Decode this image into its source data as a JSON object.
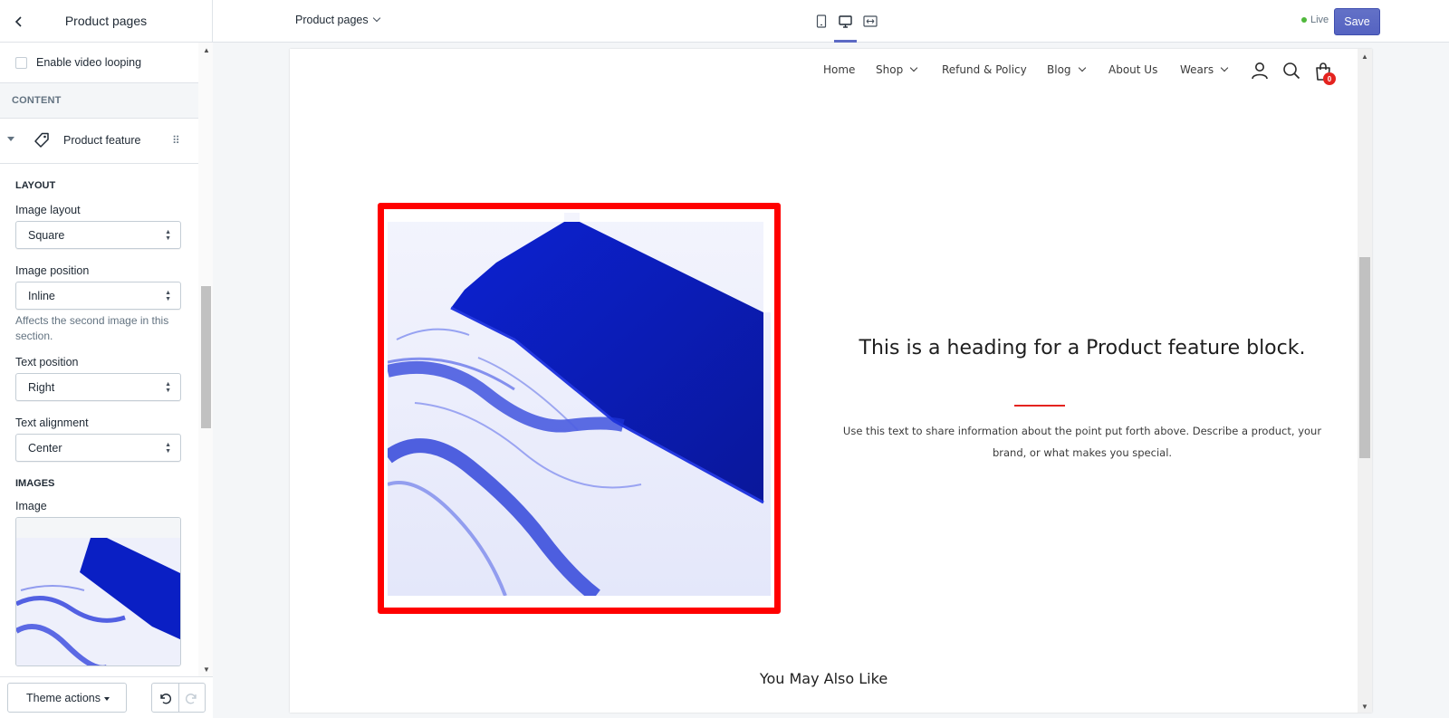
{
  "sidebar": {
    "title": "Product pages",
    "enable_video_looping": "Enable video looping",
    "content_section": "CONTENT",
    "block_label": "Product feature",
    "layout_group": "LAYOUT",
    "image_layout_label": "Image layout",
    "image_layout_value": "Square",
    "image_position_label": "Image position",
    "image_position_value": "Inline",
    "image_position_help": "Affects the second image in this section.",
    "text_position_label": "Text position",
    "text_position_value": "Right",
    "text_alignment_label": "Text alignment",
    "text_alignment_value": "Center",
    "images_group": "IMAGES",
    "image_label": "Image",
    "theme_actions": "Theme actions"
  },
  "topbar": {
    "page_select": "Product pages",
    "status": "Live",
    "save": "Save",
    "accent_color": "#5c6ac4",
    "live_color": "#50b83c"
  },
  "store": {
    "nav": [
      "Home",
      "Shop",
      "Refund & Policy",
      "Blog",
      "About Us",
      "Wears"
    ],
    "cart_count": "0",
    "feature_heading": "This is a heading for a Product feature block.",
    "feature_text": "Use this text to share information about the point put forth above. Describe a product, your brand, or what makes you special.",
    "also_like": "You May Also Like",
    "accent_color": "#e4231f",
    "highlight_color": "#ff0000"
  }
}
